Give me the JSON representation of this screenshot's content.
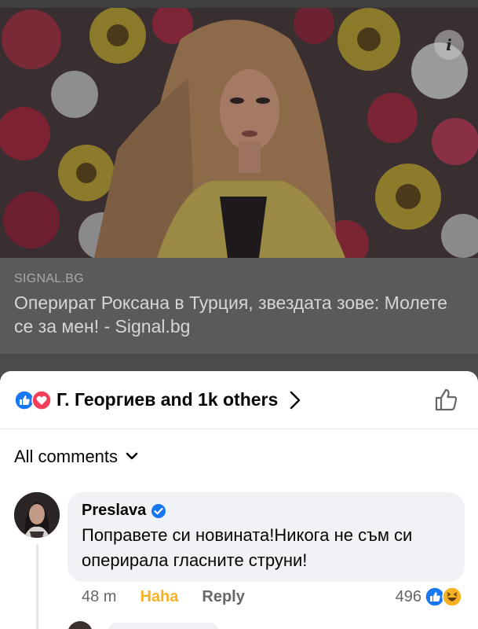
{
  "post": {
    "info_icon": "i",
    "link_domain": "SIGNAL.BG",
    "link_title": "Оперират Роксана в Турция, звездата зове: Молете се за мен! - Signal.bg"
  },
  "reactions": {
    "icons": [
      "like-icon",
      "love-icon"
    ],
    "summary": "Г. Георгиев and 1k others"
  },
  "comments_filter": {
    "label": "All comments"
  },
  "comment": {
    "author": "Preslava",
    "verified": true,
    "text": "Поправете си новината!Никога не съм си оперирала гласните струни!",
    "time": "48 m",
    "reaction_label": "Haha",
    "reply_label": "Reply",
    "reaction_count": "496",
    "reaction_icons": [
      "like-icon",
      "haha-icon"
    ]
  },
  "colors": {
    "facebook_blue": "#1877f2",
    "love_red": "#f33e58",
    "haha_yellow": "#f7b125",
    "secondary_text": "#65676b",
    "bubble_bg": "#f0f2f5"
  }
}
